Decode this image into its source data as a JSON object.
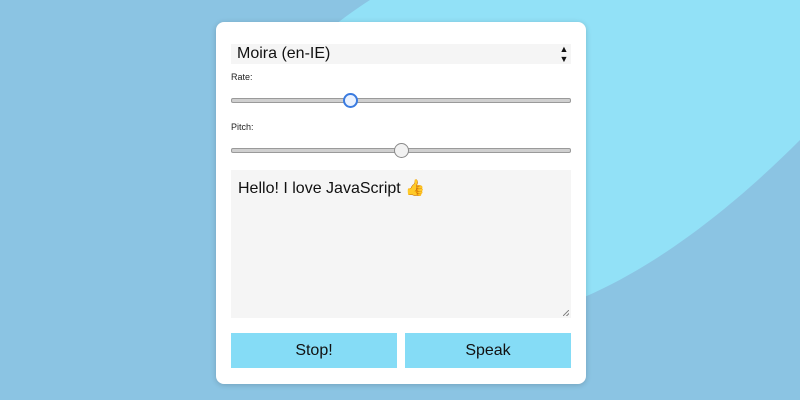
{
  "background": {
    "base_color": "#92e1f7",
    "wave_colors": [
      "#14275e",
      "#1d3a76",
      "#2a4e8c",
      "#3b64a0",
      "#4c7cb2",
      "#5f94c3",
      "#75acd4",
      "#8bc4e3"
    ]
  },
  "voice_select": {
    "value": "Moira (en-IE)",
    "arrow_icon": "up-down-arrows-icon"
  },
  "rate": {
    "label": "Rate:",
    "level": 0.35
  },
  "pitch": {
    "label": "Pitch:",
    "level": 0.5
  },
  "text_input": {
    "value": "Hello! I love JavaScript 👍"
  },
  "buttons": {
    "stop_label": "Stop!",
    "speak_label": "Speak",
    "color": "#85dcf6"
  }
}
